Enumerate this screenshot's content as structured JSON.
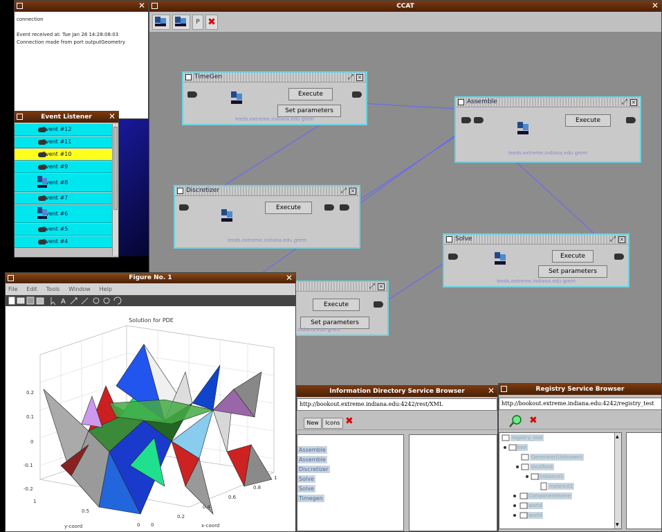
{
  "colors": {
    "titlebar": "#5a2808",
    "canvas": "#8c8c8c",
    "component_border": "#6ad2e0",
    "link": "#6a6af0",
    "event_item": "#00e6ee",
    "event_selected": "#ffff20"
  },
  "log_window": {
    "title": "",
    "lines": [
      "connection",
      "",
      "Event received at: Tue Jan 28 14:28:08:03",
      "Connection made from port outputGeometry"
    ]
  },
  "ccat": {
    "title": "CCAT",
    "toolbar": {
      "icons": [
        "component-icon",
        "component-icon",
        "properties-icon",
        "delete-icon"
      ],
      "properties_label": "P"
    }
  },
  "components": {
    "timegen": {
      "title": "TimeGen",
      "execute": "Execute",
      "params": "Set parameters",
      "host": "leeds.extreme.indiana.edu grem"
    },
    "assemble": {
      "title": "Assemble",
      "execute": "Execute",
      "host": "leeds.extreme.indiana.edu grem"
    },
    "discretizer": {
      "title": "Discretizer",
      "execute": "Execute",
      "host": "leeds.extreme.indiana.edu grem"
    },
    "solve": {
      "title": "Solve",
      "execute": "Execute",
      "params": "Set parameters",
      "host": "leeds.extreme.indiana.edu grem"
    },
    "partial": {
      "execute": "Execute",
      "params": "Set parameters",
      "host": "indiana.edu grem"
    }
  },
  "event_listener": {
    "title": "Event Listener",
    "items": [
      "Event #12",
      "Event #11",
      "Event #10",
      "Event #9",
      "Event #8",
      "Event #7",
      "Event #6",
      "Event #5",
      "Event #4"
    ],
    "selected_index": 2
  },
  "figure": {
    "title": "Figure No. 1",
    "menu": [
      "File",
      "Edit",
      "Tools",
      "Window",
      "Help"
    ],
    "toolbar_icons": [
      "new-icon",
      "open-icon",
      "save-icon",
      "print-icon",
      "arrow-icon",
      "text-icon",
      "line-arrow-icon",
      "line-icon",
      "zoom-in-icon",
      "zoom-out-icon",
      "rotate-icon"
    ],
    "chart_data": {
      "type": "surface3d",
      "title": "Solution for PDE",
      "xlabel": "x-coord",
      "ylabel": "y-coord",
      "zticks": [
        "0.2",
        "0.1",
        "0",
        "-0.1",
        "-0.2"
      ],
      "xticks": [
        "1",
        "0.8",
        "0.6",
        "0.4",
        "0.2",
        "0"
      ],
      "yticks": [
        "1",
        "0.5",
        "0"
      ]
    }
  },
  "info_browser": {
    "title": "Information Directory Service Browser",
    "url": "http://bookout.extreme.indiana.edu:4242/rest/XML",
    "buttons": {
      "new": "New",
      "icons": "Icons"
    },
    "list": [
      "Assemble",
      "Assemble",
      "Discretizer",
      "Solve",
      "Solve",
      "Timegen"
    ]
  },
  "registry_browser": {
    "title": "Registry Service Browser",
    "url": "http://bookout.extreme.indiana.edu:4242/registry_test",
    "tree": [
      "registry_root",
      "tool",
      "Generator(Unknown)",
      "localhost",
      "instance1",
      "instance2",
      "(blank)",
      "ComponentHome",
      "world",
      "world"
    ]
  }
}
